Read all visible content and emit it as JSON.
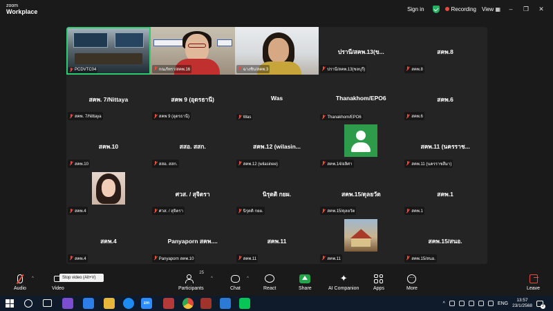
{
  "app": {
    "brand_line1": "zoom",
    "brand_line2": "Workplace",
    "sign_in": "Sign in",
    "recording": "Recording",
    "view": "View"
  },
  "colors": {
    "active_border": "#2ecc71",
    "mute_red": "#e74c3c",
    "share_green": "#21a64a",
    "background": "#1a1a1a",
    "tile_bg": "#242424"
  },
  "tiles": [
    {
      "name": "",
      "label": "PCDVTC04",
      "kind": "video-room",
      "active": true
    },
    {
      "name": "",
      "label": "กณภัทรา/สคพ.16",
      "kind": "video-woman"
    },
    {
      "name": "",
      "label": "ฉางชิบ/สคพ.3",
      "kind": "video-girl"
    },
    {
      "name": "ปรานี/สคพ.13(ข...",
      "label": "ปรานี/สคพ.13(ชลบุรี)",
      "kind": "name"
    },
    {
      "name": "สคพ.8",
      "label": "สคพ.8",
      "kind": "name"
    },
    {
      "name": "สคพ. 7/Nittaya",
      "label": "สคพ. 7/Nittaya",
      "kind": "name"
    },
    {
      "name": "สคพ 9 (อุดรธานี)",
      "label": "สคพ 9 (อุดรธานี)",
      "kind": "name"
    },
    {
      "name": "Was",
      "label": "Was",
      "kind": "name"
    },
    {
      "name": "Thanakhom/EPO6",
      "label": "Thanakhom/EPO6",
      "kind": "name"
    },
    {
      "name": "สคพ.6",
      "label": "สคพ.6",
      "kind": "name"
    },
    {
      "name": "สคพ.10",
      "label": "สคพ.10",
      "kind": "name"
    },
    {
      "name": "สสอ. สสก.",
      "label": "สสอ. สสก.",
      "kind": "name"
    },
    {
      "name": "สคพ.12 (wilasin...",
      "label": "สคพ.12 (wilasinee)",
      "kind": "name"
    },
    {
      "name": "",
      "label": "สคพ.14/อลิศา",
      "kind": "avatar"
    },
    {
      "name": "สคพ.11 (นครราช...",
      "label": "สคพ.11 (นครราชสีมา)",
      "kind": "name"
    },
    {
      "name": "",
      "label": "สคพ.4",
      "kind": "photo-girl"
    },
    {
      "name": "ศวส. / สุจิตรา",
      "label": "ศวส. / สุจิตรา",
      "kind": "name"
    },
    {
      "name": "นิรุตติ กยผ.",
      "label": "นิรุตติ กยผ.",
      "kind": "name"
    },
    {
      "name": "สคพ.15/ดุลยวัต",
      "label": "สคพ.15/ดุลยวัต",
      "kind": "name"
    },
    {
      "name": "สคพ.1",
      "label": "สคพ.1",
      "kind": "name"
    },
    {
      "name": "สคพ.4",
      "label": "สคพ.4",
      "kind": "name"
    },
    {
      "name": "Panyaporn สคพ....",
      "label": "Panyaporn สคพ.10",
      "kind": "name"
    },
    {
      "name": "สคพ.11",
      "label": "สคพ.11",
      "kind": "name"
    },
    {
      "name": "",
      "label": "สคพ.11",
      "kind": "photo-temple"
    },
    {
      "name": "สคพ.15/สนอ.",
      "label": "สคพ.15/สนอ.",
      "kind": "name"
    }
  ],
  "toolbar": {
    "audio": "Audio",
    "video": "Video",
    "tooltip": "Stop video (Alt+V)",
    "participants": "Participants",
    "participants_count": "25",
    "chat": "Chat",
    "react": "React",
    "share": "Share",
    "ai_companion": "AI Companion",
    "apps": "Apps",
    "more": "More",
    "leave": "Leave"
  },
  "taskbar": {
    "zoom_app": "zm",
    "lang": "ENG",
    "time": "13:57",
    "date": "23/1/2568",
    "notification_count": "2"
  }
}
